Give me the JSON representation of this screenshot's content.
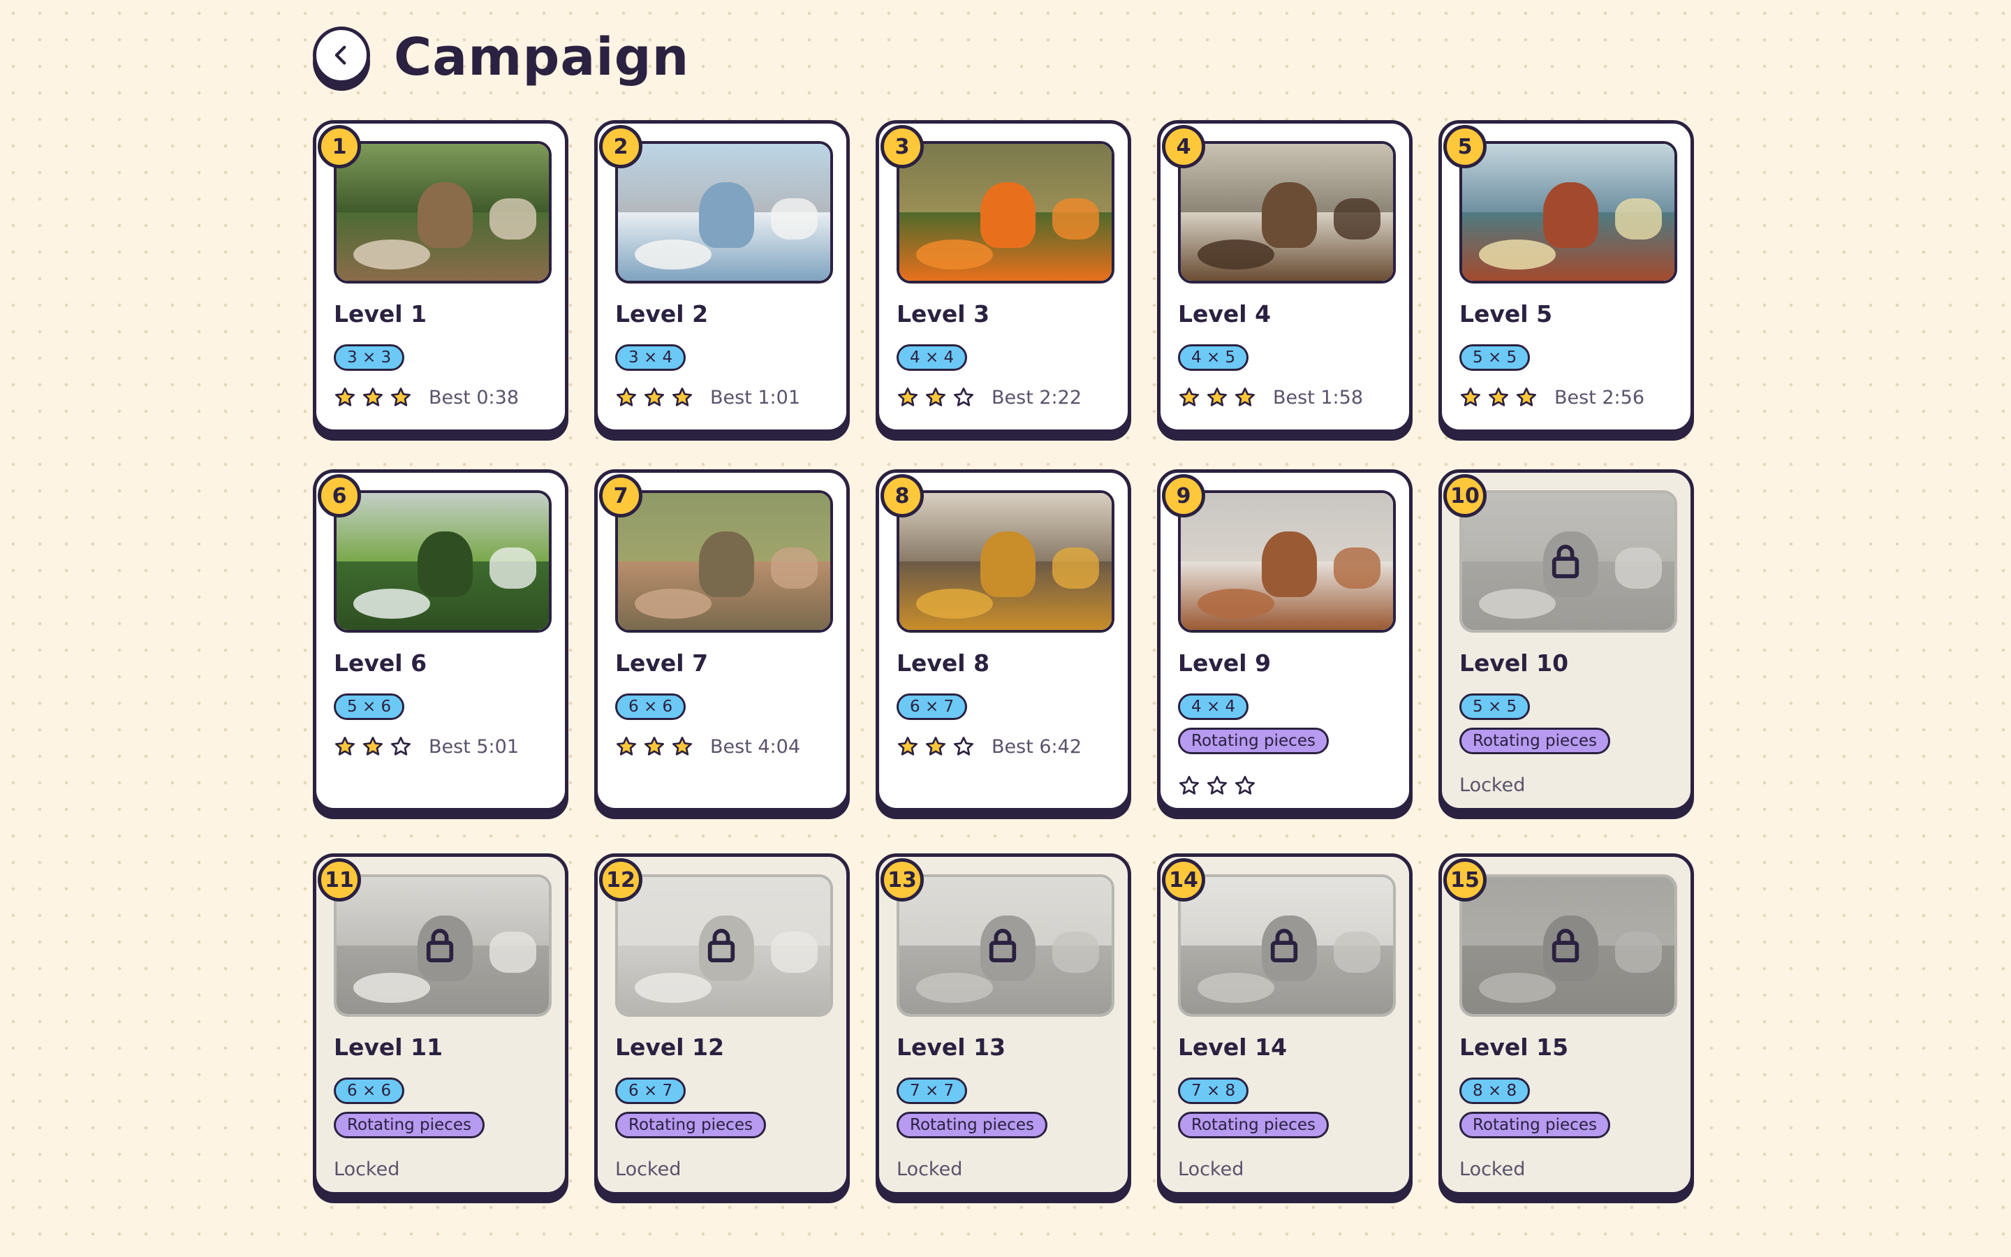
{
  "header": {
    "title": "Campaign",
    "back_icon": "chevron-left-icon"
  },
  "colors": {
    "background": "#fdf4e3",
    "ink": "#2b2140",
    "badge": "#ffc83a",
    "size_tag": "#6cc9f5",
    "modifier_tag": "#b79bf0",
    "star": "#ffc83a",
    "locked_card": "#f0ece2"
  },
  "levels": [
    {
      "number": "1",
      "name": "Level 1",
      "size": "3 × 3",
      "stars": 3,
      "best": "Best 0:38",
      "modifier": null,
      "locked": false,
      "palette": [
        "#7e9a5a",
        "#4c6b35",
        "#d9cdb8",
        "#8a6c4a",
        "#3f5a2a"
      ]
    },
    {
      "number": "2",
      "name": "Level 2",
      "size": "3 × 4",
      "stars": 3,
      "best": "Best 1:01",
      "modifier": null,
      "locked": false,
      "palette": [
        "#bcd5e6",
        "#e9eef2",
        "#f4f4f2",
        "#7fa3c0",
        "#b3b8bd"
      ]
    },
    {
      "number": "3",
      "name": "Level 3",
      "size": "4 × 4",
      "stars": 2,
      "best": "Best 2:22",
      "modifier": null,
      "locked": false,
      "palette": [
        "#7b7a4e",
        "#4f6a2c",
        "#f08a2a",
        "#e8701c",
        "#9a8e55"
      ]
    },
    {
      "number": "4",
      "name": "Level 4",
      "size": "4 × 5",
      "stars": 3,
      "best": "Best 1:58",
      "modifier": null,
      "locked": false,
      "palette": [
        "#c9c2b2",
        "#d7d1c4",
        "#4a3526",
        "#6a4d34",
        "#8c8575"
      ]
    },
    {
      "number": "5",
      "name": "Level 5",
      "size": "5 × 5",
      "stars": 3,
      "best": "Best 2:56",
      "modifier": null,
      "locked": false,
      "palette": [
        "#c4d6de",
        "#4f7b82",
        "#e9dca8",
        "#a34a2e",
        "#6e8fa0"
      ]
    },
    {
      "number": "6",
      "name": "Level 6",
      "size": "5 × 6",
      "stars": 2,
      "best": "Best 5:01",
      "modifier": null,
      "locked": false,
      "palette": [
        "#c3cfc6",
        "#3d6b2e",
        "#e8eee9",
        "#2f4f22",
        "#7aa84a"
      ]
    },
    {
      "number": "7",
      "name": "Level 7",
      "size": "6 × 6",
      "stars": 3,
      "best": "Best 4:04",
      "modifier": null,
      "locked": false,
      "palette": [
        "#8f9a68",
        "#b98f6c",
        "#c9a486",
        "#7a6a4d",
        "#a0a46a"
      ]
    },
    {
      "number": "8",
      "name": "Level 8",
      "size": "6 × 7",
      "stars": 2,
      "best": "Best 6:42",
      "modifier": null,
      "locked": false,
      "palette": [
        "#d9cfc0",
        "#6b5a48",
        "#e2a93b",
        "#c98d2a",
        "#8a7b68"
      ]
    },
    {
      "number": "9",
      "name": "Level 9",
      "size": "4 × 4",
      "stars": 0,
      "best": "",
      "modifier": "Rotating pieces",
      "locked": false,
      "palette": [
        "#c9c6c2",
        "#e6e1dc",
        "#b06a40",
        "#9a5a34",
        "#d8d2cb"
      ]
    },
    {
      "number": "10",
      "name": "Level 10",
      "size": "5 × 5",
      "stars": 0,
      "best": "",
      "modifier": "Rotating pieces",
      "locked": true,
      "status": "Locked",
      "palette": [
        "#9a9a9a",
        "#6e6e6e",
        "#bdbdbd",
        "#5a5a5a",
        "#888888"
      ]
    },
    {
      "number": "11",
      "name": "Level 11",
      "size": "6 × 6",
      "stars": 0,
      "best": "",
      "modifier": "Rotating pieces",
      "locked": true,
      "status": "Locked",
      "palette": [
        "#c8c8c8",
        "#6a6a6a",
        "#e0e0e0",
        "#4e4e4e",
        "#9a9a9a"
      ]
    },
    {
      "number": "12",
      "name": "Level 12",
      "size": "6 × 7",
      "stars": 0,
      "best": "",
      "modifier": "Rotating pieces",
      "locked": true,
      "status": "Locked",
      "palette": [
        "#d6d6d6",
        "#b5b5b5",
        "#e6e6e6",
        "#8a8a8a",
        "#cfcfcf"
      ]
    },
    {
      "number": "13",
      "name": "Level 13",
      "size": "7 × 7",
      "stars": 0,
      "best": "",
      "modifier": "Rotating pieces",
      "locked": true,
      "status": "Locked",
      "palette": [
        "#cfcfcf",
        "#7d7d7d",
        "#a6a6a6",
        "#5e5e5e",
        "#bcbcbc"
      ]
    },
    {
      "number": "14",
      "name": "Level 14",
      "size": "7 × 8",
      "stars": 0,
      "best": "",
      "modifier": "Rotating pieces",
      "locked": true,
      "status": "Locked",
      "palette": [
        "#dcdcdc",
        "#7a7a7a",
        "#a8a8a8",
        "#555555",
        "#c2c2c2"
      ]
    },
    {
      "number": "15",
      "name": "Level 15",
      "size": "8 × 8",
      "stars": 0,
      "best": "",
      "modifier": "Rotating pieces",
      "locked": true,
      "status": "Locked",
      "palette": [
        "#6d6d6d",
        "#4a4a4a",
        "#8a8a8a",
        "#3a3a3a",
        "#7a7a7a"
      ]
    }
  ]
}
